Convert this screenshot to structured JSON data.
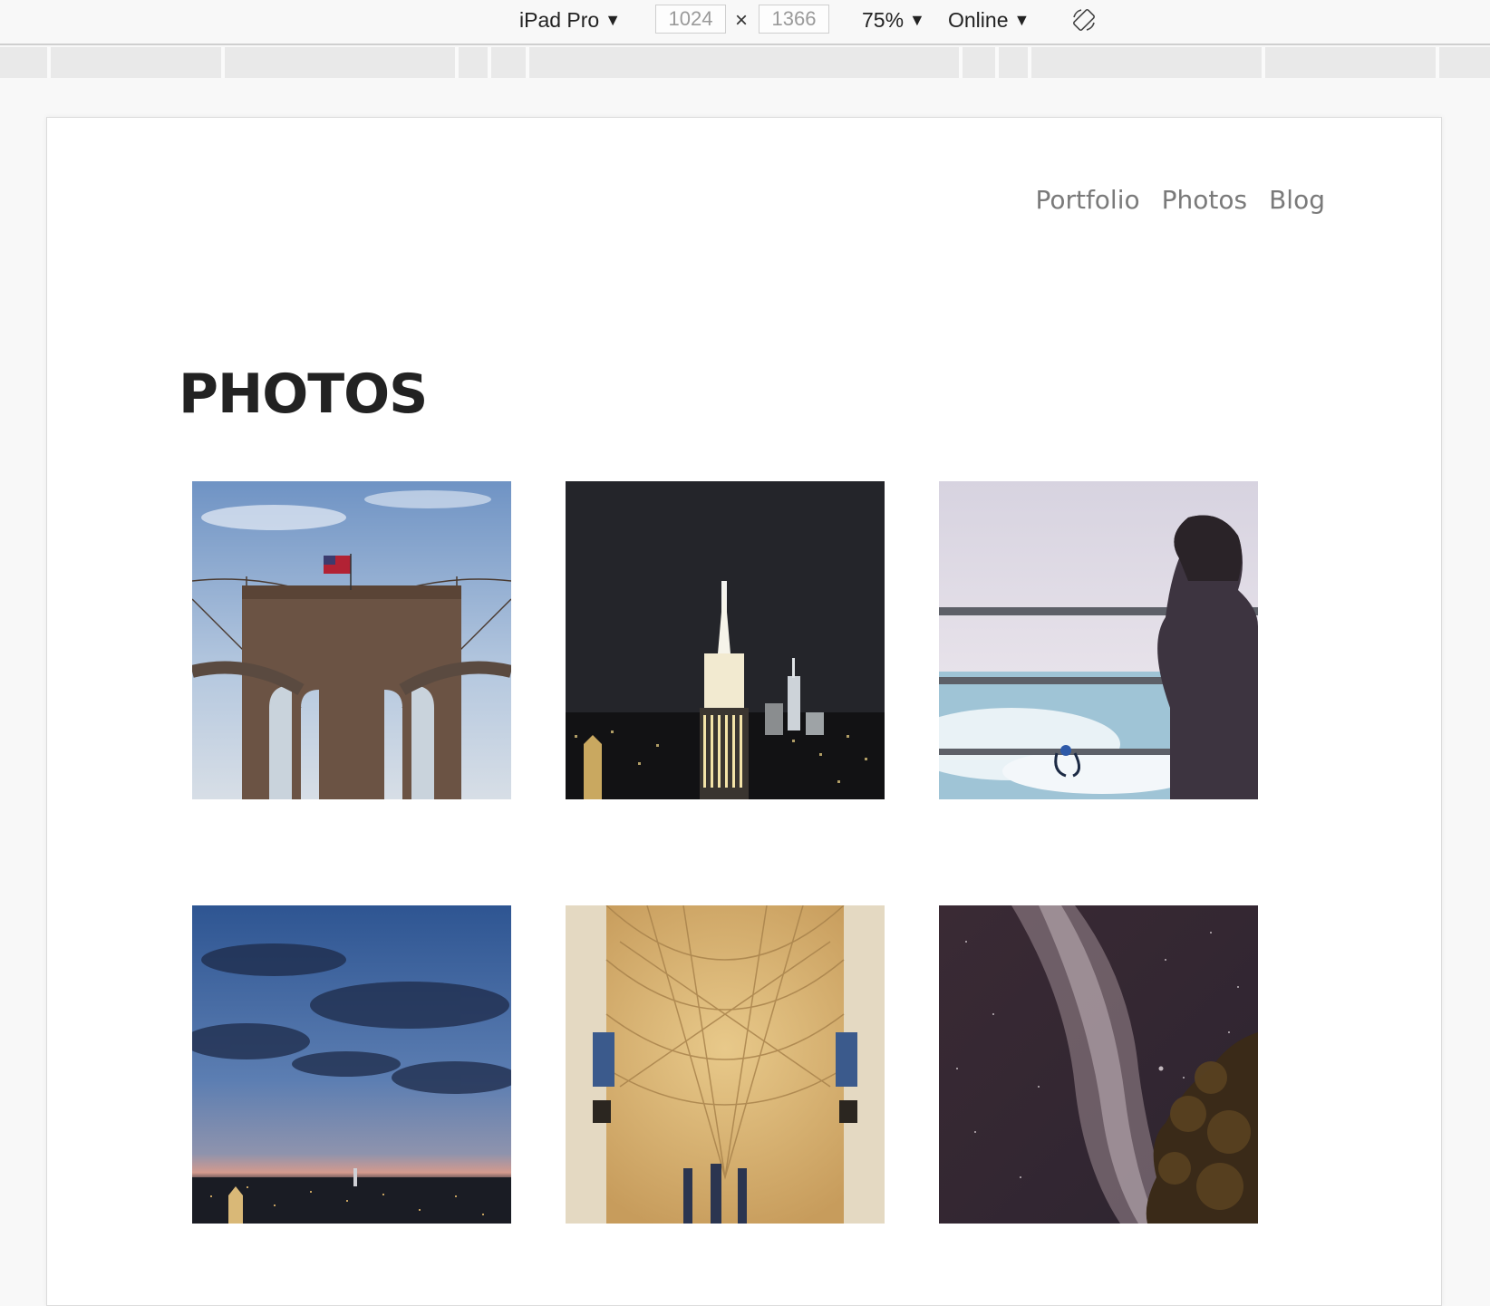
{
  "toolbar": {
    "device": "iPad Pro",
    "width_value": "1024",
    "height_value": "1366",
    "times_symbol": "×",
    "zoom": "75%",
    "network": "Online",
    "dropdown_glyph": "▼",
    "rotate_icon": "rotate-device-icon"
  },
  "nav": {
    "items": [
      "Portfolio",
      "Photos",
      "Blog"
    ]
  },
  "page": {
    "title": "PHOTOS"
  },
  "photos": [
    {
      "subject": "brooklyn-bridge-photo"
    },
    {
      "subject": "empire-state-night-photo"
    },
    {
      "subject": "person-at-railing-photo"
    },
    {
      "subject": "city-dusk-skyline-photo"
    },
    {
      "subject": "cathedral-ceiling-photo"
    },
    {
      "subject": "milky-way-photo"
    }
  ],
  "colors": {
    "title": "#222222",
    "nav_text": "#7a7a7a",
    "background": "#f8f8f8",
    "page": "#ffffff"
  }
}
